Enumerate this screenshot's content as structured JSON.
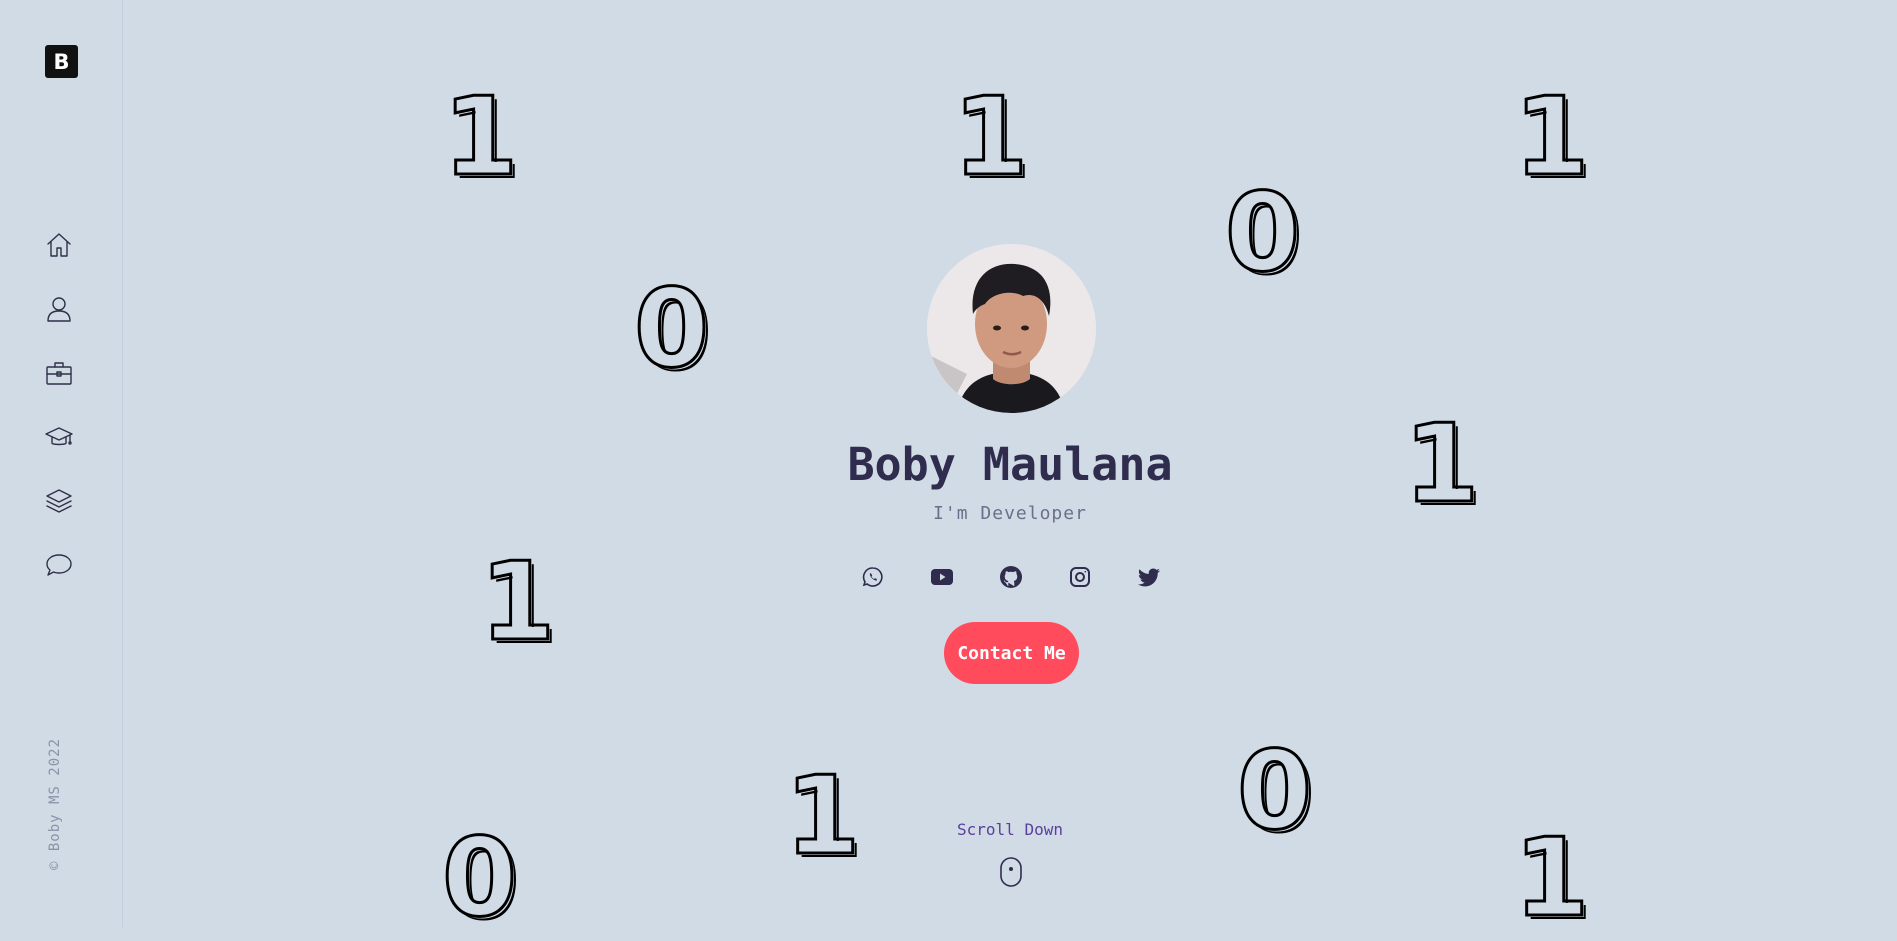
{
  "sidebar": {
    "logo": "B",
    "nav": [
      "home-icon",
      "user-icon",
      "briefcase-icon",
      "graduation-cap-icon",
      "layers-icon",
      "chat-icon"
    ],
    "copyright": "© Boby MS 2022"
  },
  "hero": {
    "name": "Boby Maulana",
    "role": "I'm Developer",
    "socials": [
      "whatsapp-icon",
      "youtube-icon",
      "github-icon",
      "instagram-icon",
      "twitter-icon"
    ],
    "contact_label": "Contact Me",
    "scroll_label": "Scroll Down"
  },
  "background_digits": [
    "1",
    "1",
    "1",
    "0",
    "0",
    "1",
    "1",
    "1",
    "0",
    "0",
    "1"
  ],
  "colors": {
    "background": "#d1dbe6",
    "accent": "#ff4b5c",
    "text_dark": "#2f2c4e",
    "scroll_text": "#5b3f9c"
  }
}
